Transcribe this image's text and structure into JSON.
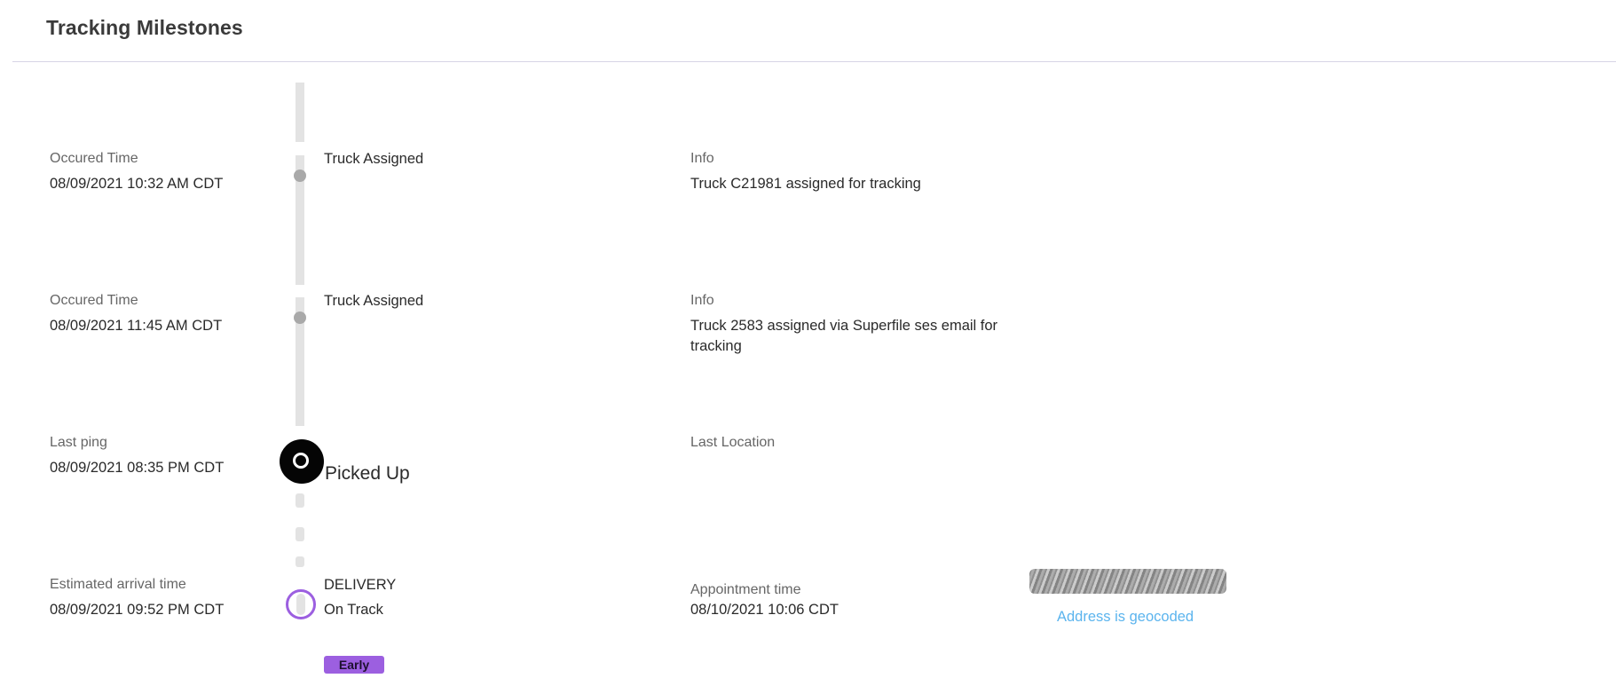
{
  "header": {
    "title": "Tracking Milestones"
  },
  "milestones": [
    {
      "time_label": "Occured Time",
      "time_value": "08/09/2021 10:32 AM CDT",
      "status": "Truck Assigned",
      "info_label": "Info",
      "info_value": "Truck C21981 assigned for tracking"
    },
    {
      "time_label": "Occured Time",
      "time_value": "08/09/2021 11:45 AM CDT",
      "status": "Truck Assigned",
      "info_label": "Info",
      "info_value": "Truck 2583 assigned via Superfile ses email for tracking"
    },
    {
      "time_label": "Last ping",
      "time_value": "08/09/2021 08:35 PM CDT",
      "status": "Picked Up",
      "info_label": "Last Location"
    },
    {
      "time_label": "Estimated arrival time",
      "time_value": "08/09/2021 09:52 PM CDT",
      "status": "DELIVERY",
      "substatus": "On Track",
      "badge": "Early",
      "info_label": "Appointment time",
      "info_value": "08/10/2021 10:06 CDT",
      "address_link": "Address is geocoded"
    }
  ],
  "colors": {
    "accent_purple": "#9c5fe0",
    "link_blue": "#5bb4ee",
    "timeline_gray": "#e3e3e3",
    "dot_gray": "#a9a9a9",
    "current_dot": "#050505"
  },
  "icons": {
    "milestone_dot": "small-gray-dot-icon",
    "current_marker": "ring-marker-icon",
    "delivery_marker": "delivery-ring-icon",
    "address": "redacted-address"
  }
}
